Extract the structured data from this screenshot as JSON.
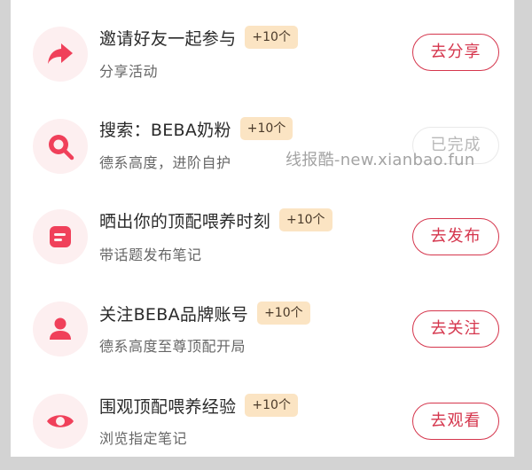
{
  "tasks": [
    {
      "title": "邀请好友一起参与",
      "badge": "+10个",
      "subtitle": "分享活动",
      "action": "去分享",
      "icon": "share-icon",
      "completed": false
    },
    {
      "title": "搜索：BEBA奶粉",
      "badge": "+10个",
      "subtitle": "德系高度，进阶自护",
      "action": "已完成",
      "icon": "search-icon",
      "completed": true
    },
    {
      "title": "晒出你的顶配喂养时刻",
      "badge": "+10个",
      "subtitle": "带话题发布笔记",
      "action": "去发布",
      "icon": "note-icon",
      "completed": false
    },
    {
      "title": "关注BEBA品牌账号",
      "badge": "+10个",
      "subtitle": "德系高度至尊顶配开局",
      "action": "去关注",
      "icon": "user-icon",
      "completed": false
    },
    {
      "title": "围观顶配喂养经验",
      "badge": "+10个",
      "subtitle": "浏览指定笔记",
      "action": "去观看",
      "icon": "eye-icon",
      "completed": false
    }
  ],
  "watermark": "线报酷-new.xianbao.fun",
  "colors": {
    "accent": "#d5364d",
    "icon_bg": "#fdeff0",
    "badge_bg": "#fbe4c3"
  }
}
